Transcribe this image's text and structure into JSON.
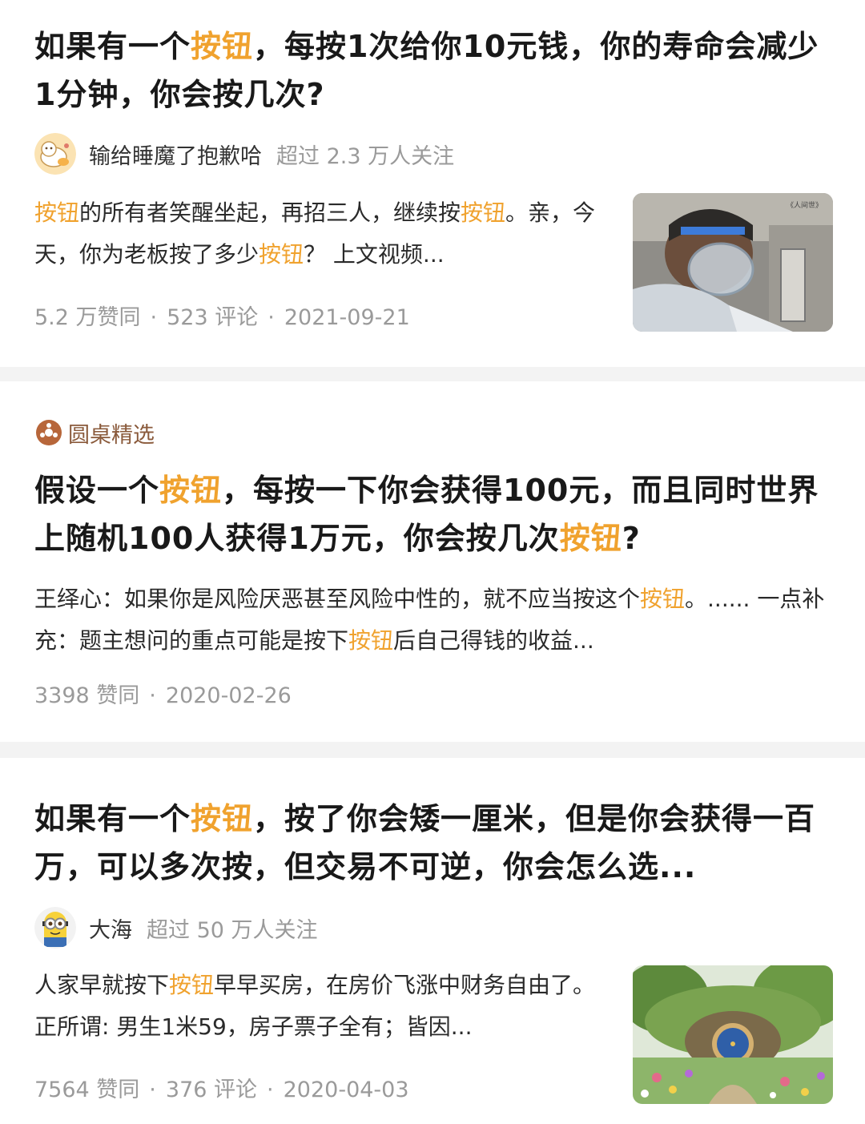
{
  "colors": {
    "highlight": "#f0a22e",
    "tag": "#8a5a3b",
    "meta": "#9a9a9a"
  },
  "cards": [
    {
      "title_parts": [
        "如果有一个",
        "按钮",
        "，每按1次给你10元钱，你的寿命会减少1分钟，你会按几次?"
      ],
      "author": {
        "name": "输给睡魔了抱歉哈",
        "followers": "超过 2.3 万人关注",
        "avatar_icon": "cartoon-cat-avatar-icon"
      },
      "snippet_parts": [
        "按钮",
        "的所有者笑醒坐起，再招三人，继续按",
        "按钮",
        "。亲，今天，你为老板按了多少",
        "按钮",
        "？ 上文视频..."
      ],
      "meta": {
        "likes": "5.2 万赞同",
        "comments": "523 评论",
        "date": "2021-09-21"
      },
      "thumbnail": {
        "icon": "hospital-patient-photo",
        "caption": "《人间世》"
      }
    },
    {
      "tag": {
        "icon": "roundtable-icon",
        "label": "圆桌精选"
      },
      "title_parts": [
        "假设一个",
        "按钮",
        "，每按一下你会获得100元，而且同时世界上随机100人获得1万元，你会按几次",
        "按钮",
        "?"
      ],
      "snippet_parts": [
        "王绎心：如果你是风险厌恶甚至风险中性的，就不应当按这个",
        "按钮",
        "。...... 一点补充：题主想问的重点可能是按下",
        "按钮",
        "后自己得钱的收益..."
      ],
      "meta": {
        "likes": "3398 赞同",
        "date": "2020-02-26"
      }
    },
    {
      "title_parts": [
        "如果有一个",
        "按钮",
        "，按了你会矮一厘米，但是你会获得一百万，可以多次按，但交易不可逆，你会怎么选..."
      ],
      "author": {
        "name": "大海",
        "followers": "超过 50 万人关注",
        "avatar_icon": "minion-avatar-icon"
      },
      "snippet_parts": [
        "人家早就按下",
        "按钮",
        "早早买房，在房价飞涨中财务自由了。正所谓: 男生1米59，房子票子全有；皆因..."
      ],
      "meta": {
        "likes": "7564 赞同",
        "comments": "376 评论",
        "date": "2020-04-03"
      },
      "thumbnail": {
        "icon": "hobbit-house-garden-photo"
      }
    }
  ]
}
